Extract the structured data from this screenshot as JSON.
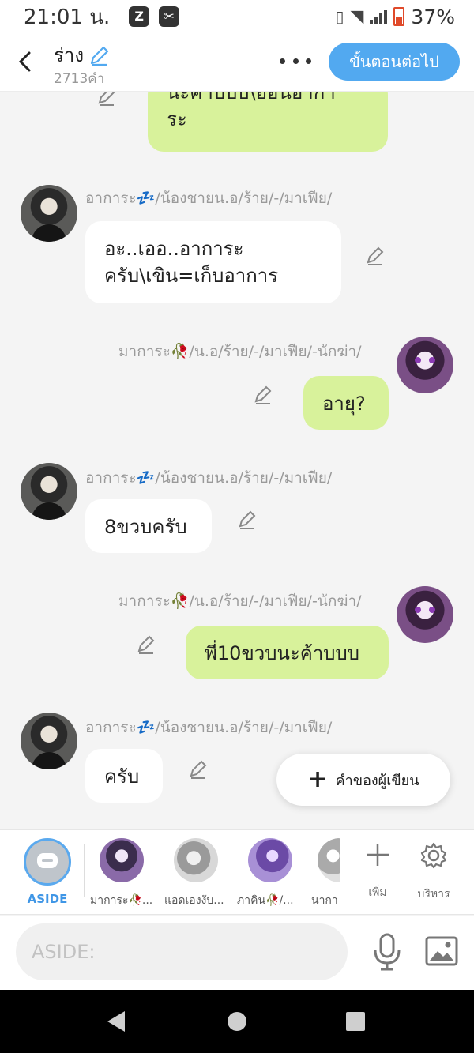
{
  "status": {
    "time": "21:01 น.",
    "battery": "37%"
  },
  "header": {
    "title": "ร่าง",
    "word_count": "2713คำ",
    "next_button": "ขั้นตอนต่อไป"
  },
  "messages": [
    {
      "side": "right",
      "name": "",
      "text_lines": [
        "นะค้าบบบ\\อ้อนอากา",
        "ระ"
      ],
      "bubble": "green"
    },
    {
      "side": "left",
      "name": "อาการะ💤/น้องชายน.อ/ร้าย/-/มาเฟีย/",
      "text_lines": [
        "อะ..เออ..อาการะ",
        "ครับ\\เขิน=เก็บอาการ"
      ],
      "bubble": "white"
    },
    {
      "side": "right",
      "name": "มาการะ🥀/น.อ/ร้าย/-/มาเฟีย/-นักฆ่า/",
      "text_lines": [
        "อายุ?"
      ],
      "bubble": "green"
    },
    {
      "side": "left",
      "name": "อาการะ💤/น้องชายน.อ/ร้าย/-/มาเฟีย/",
      "text_lines": [
        "8ขวบครับ"
      ],
      "bubble": "white"
    },
    {
      "side": "right",
      "name": "มาการะ🥀/น.อ/ร้าย/-/มาเฟีย/-นักฆ่า/",
      "text_lines": [
        "พี่10ขวบนะค้าบบบ"
      ],
      "bubble": "green"
    },
    {
      "side": "left",
      "name": "อาการะ💤/น้องชายน.อ/ร้าย/-/มาเฟีย/",
      "text_lines": [
        "ครับ"
      ],
      "bubble": "white"
    }
  ],
  "writer_button": "คำของผู้เขียน",
  "charbar": {
    "aside_label": "ASIDE",
    "characters": [
      "มาการะ🥀...",
      "แอดเองงับ...",
      "ภาคิน🥀/...",
      "นากา"
    ],
    "add_label": "เพิ่ม",
    "manage_label": "บริหาร"
  },
  "input": {
    "placeholder": "ASIDE:"
  },
  "colors": {
    "accent": "#52a9f0",
    "bubble_green": "#d8f29b",
    "bubble_white": "#ffffff"
  },
  "icons": [
    "back-arrow-icon",
    "pencil-icon",
    "more-icon",
    "plus-icon",
    "gear-icon",
    "mic-icon",
    "image-icon"
  ]
}
